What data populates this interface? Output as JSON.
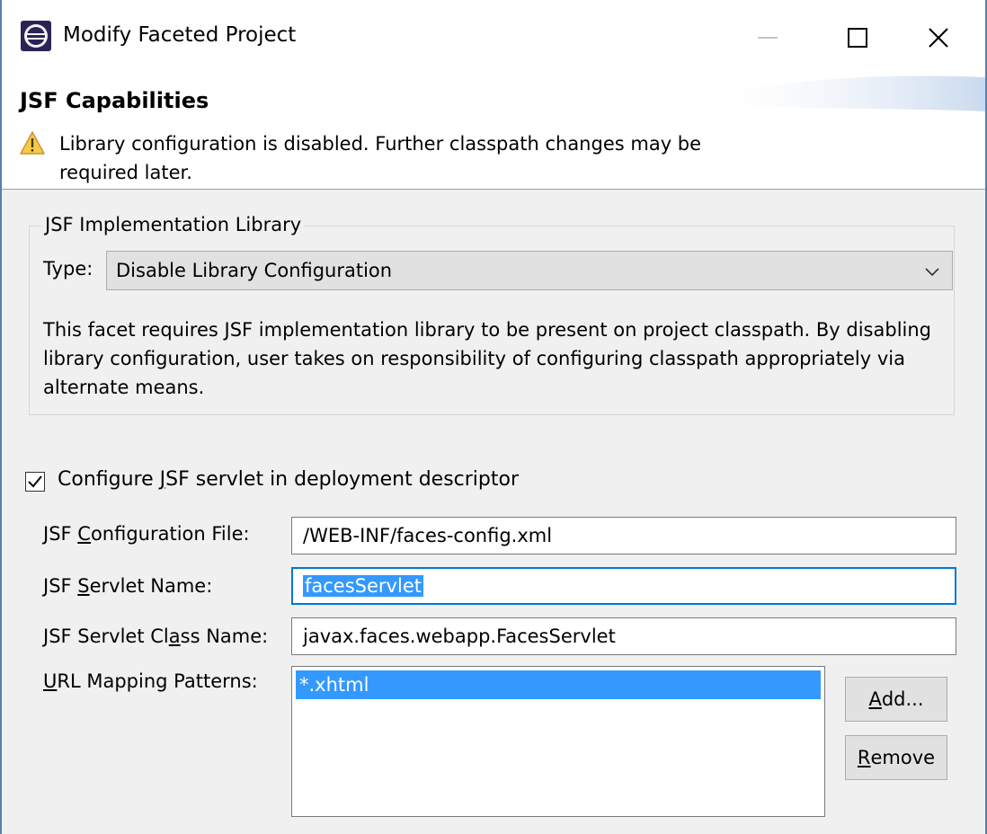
{
  "window": {
    "title": "Modify Faceted Project",
    "icon": "eclipse-icon",
    "controls": [
      "minimize-icon",
      "maximize-icon",
      "close-icon"
    ]
  },
  "header": {
    "title": "JSF Capabilities",
    "warning_icon": "warning-icon",
    "warning_text": "Library configuration is disabled. Further classpath changes may be required later."
  },
  "library_group": {
    "legend": "JSF Implementation Library",
    "type_label": "Type:",
    "type_value": "Disable Library Configuration",
    "description": "This facet requires JSF implementation library to be present on project classpath. By disabling library configuration, user takes on responsibility of configuring classpath appropriately via alternate means."
  },
  "servlet": {
    "checkbox_checked": true,
    "checkbox_label_pre": "Configure ",
    "checkbox_label_mnemonic": "J",
    "checkbox_label_post": "SF servlet in deployment descriptor",
    "config_file_label_pre": "JSF ",
    "config_file_label_mnemonic": "C",
    "config_file_label_post": "onfiguration File:",
    "config_file_value": "/WEB-INF/faces-config.xml",
    "servlet_name_label_pre": "JSF ",
    "servlet_name_label_mnemonic": "S",
    "servlet_name_label_post": "ervlet Name:",
    "servlet_name_value": "facesServlet",
    "class_name_label_pre": "JSF Servlet Cl",
    "class_name_label_mnemonic": "a",
    "class_name_label_post": "ss Name:",
    "class_name_value": "javax.faces.webapp.FacesServlet",
    "url_label_mnemonic": "U",
    "url_label_post": "RL Mapping Patterns:",
    "url_patterns": [
      "*.xhtml"
    ],
    "add_mnemonic": "A",
    "add_post": "dd...",
    "remove_mnemonic": "R",
    "remove_post": "emove"
  },
  "colors": {
    "selection": "#3399ff",
    "focus_border": "#0078d7",
    "panel_bg": "#f0f0f0"
  }
}
